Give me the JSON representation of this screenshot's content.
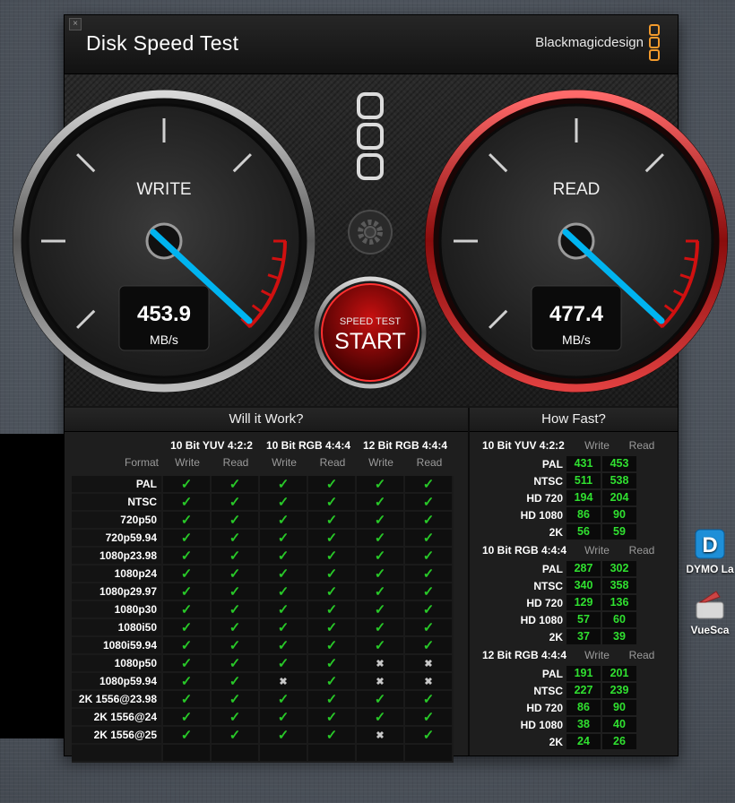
{
  "window": {
    "title": "Disk Speed Test",
    "brand": "Blackmagicdesign",
    "close_label": "×"
  },
  "gauges": {
    "write": {
      "label": "WRITE",
      "value": "453.9",
      "unit": "MB/s"
    },
    "read": {
      "label": "READ",
      "value": "477.4",
      "unit": "MB/s"
    }
  },
  "start_button": {
    "top": "SPEED TEST",
    "main": "START"
  },
  "will_it_work": {
    "title": "Will it Work?",
    "format_header": "Format",
    "groups": [
      "10 Bit YUV 4:2:2",
      "10 Bit RGB 4:4:4",
      "12 Bit RGB 4:4:4"
    ],
    "subheaders": [
      "Write",
      "Read",
      "Write",
      "Read",
      "Write",
      "Read"
    ],
    "rows": [
      {
        "format": "PAL",
        "marks": [
          1,
          1,
          1,
          1,
          1,
          1
        ]
      },
      {
        "format": "NTSC",
        "marks": [
          1,
          1,
          1,
          1,
          1,
          1
        ]
      },
      {
        "format": "720p50",
        "marks": [
          1,
          1,
          1,
          1,
          1,
          1
        ]
      },
      {
        "format": "720p59.94",
        "marks": [
          1,
          1,
          1,
          1,
          1,
          1
        ]
      },
      {
        "format": "1080p23.98",
        "marks": [
          1,
          1,
          1,
          1,
          1,
          1
        ]
      },
      {
        "format": "1080p24",
        "marks": [
          1,
          1,
          1,
          1,
          1,
          1
        ]
      },
      {
        "format": "1080p29.97",
        "marks": [
          1,
          1,
          1,
          1,
          1,
          1
        ]
      },
      {
        "format": "1080p30",
        "marks": [
          1,
          1,
          1,
          1,
          1,
          1
        ]
      },
      {
        "format": "1080i50",
        "marks": [
          1,
          1,
          1,
          1,
          1,
          1
        ]
      },
      {
        "format": "1080i59.94",
        "marks": [
          1,
          1,
          1,
          1,
          1,
          1
        ]
      },
      {
        "format": "1080p50",
        "marks": [
          1,
          1,
          1,
          1,
          0,
          0
        ]
      },
      {
        "format": "1080p59.94",
        "marks": [
          1,
          1,
          0,
          1,
          0,
          0
        ]
      },
      {
        "format": "2K 1556@23.98",
        "marks": [
          1,
          1,
          1,
          1,
          1,
          1
        ]
      },
      {
        "format": "2K 1556@24",
        "marks": [
          1,
          1,
          1,
          1,
          1,
          1
        ]
      },
      {
        "format": "2K 1556@25",
        "marks": [
          1,
          1,
          1,
          1,
          0,
          1
        ]
      }
    ]
  },
  "how_fast": {
    "title": "How Fast?",
    "col_write": "Write",
    "col_read": "Read",
    "groups": [
      {
        "name": "10 Bit YUV 4:2:2",
        "rows": [
          {
            "label": "PAL",
            "write": "431",
            "read": "453"
          },
          {
            "label": "NTSC",
            "write": "511",
            "read": "538"
          },
          {
            "label": "HD 720",
            "write": "194",
            "read": "204"
          },
          {
            "label": "HD 1080",
            "write": "86",
            "read": "90"
          },
          {
            "label": "2K",
            "write": "56",
            "read": "59"
          }
        ]
      },
      {
        "name": "10 Bit RGB 4:4:4",
        "rows": [
          {
            "label": "PAL",
            "write": "287",
            "read": "302"
          },
          {
            "label": "NTSC",
            "write": "340",
            "read": "358"
          },
          {
            "label": "HD 720",
            "write": "129",
            "read": "136"
          },
          {
            "label": "HD 1080",
            "write": "57",
            "read": "60"
          },
          {
            "label": "2K",
            "write": "37",
            "read": "39"
          }
        ]
      },
      {
        "name": "12 Bit RGB 4:4:4",
        "rows": [
          {
            "label": "PAL",
            "write": "191",
            "read": "201"
          },
          {
            "label": "NTSC",
            "write": "227",
            "read": "239"
          },
          {
            "label": "HD 720",
            "write": "86",
            "read": "90"
          },
          {
            "label": "HD 1080",
            "write": "38",
            "read": "40"
          },
          {
            "label": "2K",
            "write": "24",
            "read": "26"
          }
        ]
      }
    ]
  },
  "desktop_icons": [
    {
      "label": "DYMO La",
      "icon": "dymo-icon"
    },
    {
      "label": "VueSca",
      "icon": "vuescan-icon"
    }
  ],
  "colors": {
    "accent": "#f29a2c",
    "needle": "#00b4f0",
    "redline": "#d01010",
    "ok": "#28c828",
    "value_green": "#30e030"
  }
}
